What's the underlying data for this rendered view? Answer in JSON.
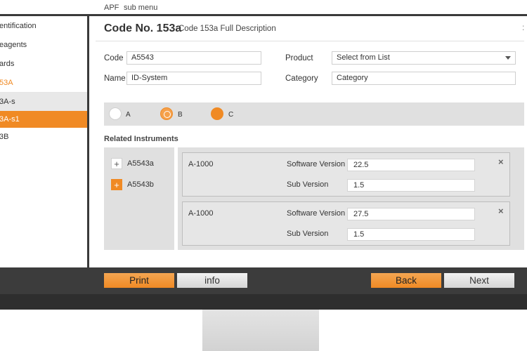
{
  "topbar": {
    "app": "APF",
    "submenu": "sub menu"
  },
  "sidebar": {
    "items": [
      {
        "label": "entification"
      },
      {
        "label": "eagents"
      },
      {
        "label": "ards"
      },
      {
        "label": "53A"
      },
      {
        "label": "3A-s"
      },
      {
        "label": "3A-s1"
      },
      {
        "label": "3B"
      }
    ]
  },
  "header": {
    "title": "Code No. 153a",
    "description": "Code 153a Full Description"
  },
  "form": {
    "code_label": "Code",
    "code_value": "A5543",
    "name_label": "Name",
    "name_value": "ID-System",
    "product_label": "Product",
    "product_value": "Select from List",
    "category_label": "Category",
    "category_value": "Category"
  },
  "radios": [
    {
      "label": "A",
      "state": "empty"
    },
    {
      "label": "B",
      "state": "selected"
    },
    {
      "label": "C",
      "state": "filled"
    }
  ],
  "related": {
    "title": "Related Instruments",
    "instruments": [
      {
        "name": "A5543a",
        "icon": "+"
      },
      {
        "name": "A5543b",
        "icon": "+"
      }
    ],
    "cards": [
      {
        "name": "A-1000",
        "software_label": "Software Version",
        "software_value": "22.5",
        "sub_label": "Sub Version",
        "sub_value": "1.5",
        "close": "×"
      },
      {
        "name": "A-1000",
        "software_label": "Software Version",
        "software_value": "27.5",
        "sub_label": "Sub Version",
        "sub_value": "1.5",
        "close": "×"
      }
    ]
  },
  "buttons": {
    "print": "Print",
    "info": "info",
    "back": "Back",
    "next": "Next"
  },
  "colors": {
    "accent": "#f08a24",
    "panel": "#e0e0e0",
    "bar": "#3c3c3c"
  }
}
